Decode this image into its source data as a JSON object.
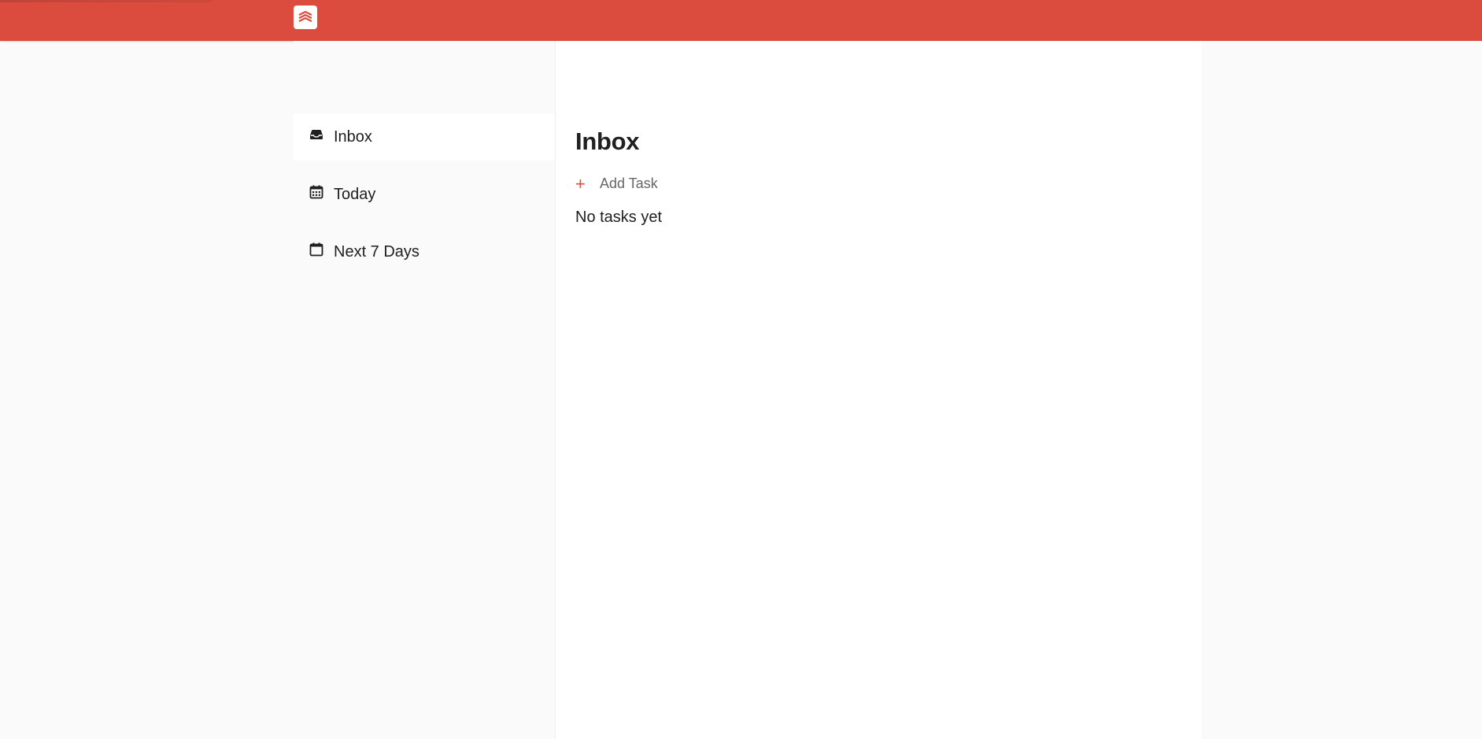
{
  "colors": {
    "brand": "#db4c3f",
    "sidebar_bg": "#fafafa",
    "main_bg": "#ffffff",
    "text": "#202020",
    "muted": "#666666"
  },
  "header": {
    "logo_icon": "todoist-logo-icon"
  },
  "sidebar": {
    "items": [
      {
        "label": "Inbox",
        "icon": "inbox-icon",
        "active": true
      },
      {
        "label": "Today",
        "icon": "calendar-day-icon",
        "active": false
      },
      {
        "label": "Next 7 Days",
        "icon": "calendar-week-icon",
        "active": false
      }
    ]
  },
  "main": {
    "title": "Inbox",
    "add_task_label": "Add Task",
    "add_task_icon": "plus-icon",
    "empty_text": "No tasks yet"
  }
}
